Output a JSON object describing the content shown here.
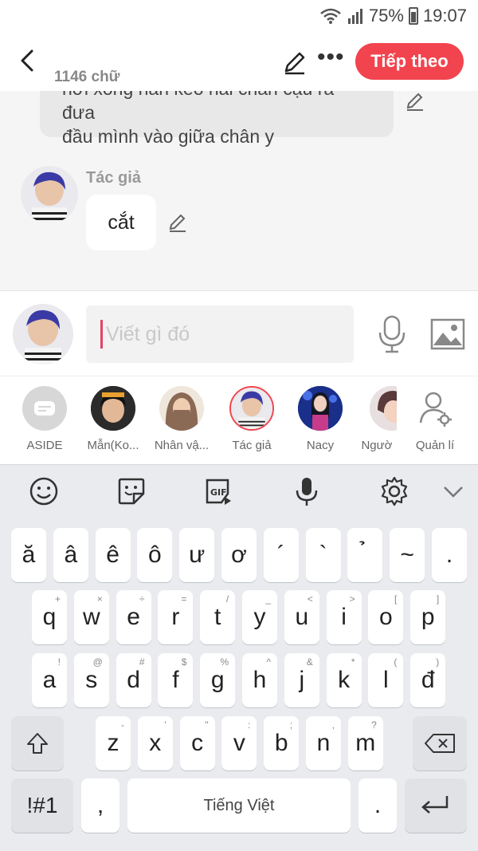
{
  "status_bar": {
    "battery": "75%",
    "time": "19:07"
  },
  "header": {
    "word_count": "1146 chữ",
    "next_label": "Tiếp theo"
  },
  "chat": {
    "prev_line1": "hơi xong hắn kéo hai chân cậu ra đưa",
    "prev_line2": "đầu mình vào giữa chân y",
    "author_role": "Tác giả",
    "message": "cắt"
  },
  "composer": {
    "placeholder": "Viết gì đó"
  },
  "characters": [
    {
      "name": "ASIDE"
    },
    {
      "name": "Mẫn(Ko..."
    },
    {
      "name": "Nhân vậ..."
    },
    {
      "name": "Tác giả"
    },
    {
      "name": "Nacy"
    },
    {
      "name": "Ngườ"
    },
    {
      "name": "Quản lí"
    }
  ],
  "keyboard": {
    "row0": [
      "ă",
      "â",
      "ê",
      "ô",
      "ư",
      "ơ",
      "´",
      "`",
      "̉",
      "~",
      "."
    ],
    "row1": [
      {
        "k": "q",
        "s": "+"
      },
      {
        "k": "w",
        "s": "×"
      },
      {
        "k": "e",
        "s": "÷"
      },
      {
        "k": "r",
        "s": "="
      },
      {
        "k": "t",
        "s": "/"
      },
      {
        "k": "y",
        "s": "_"
      },
      {
        "k": "u",
        "s": "<"
      },
      {
        "k": "i",
        "s": ">"
      },
      {
        "k": "o",
        "s": "["
      },
      {
        "k": "p",
        "s": "]"
      }
    ],
    "row2": [
      {
        "k": "a",
        "s": "!"
      },
      {
        "k": "s",
        "s": "@"
      },
      {
        "k": "d",
        "s": "#"
      },
      {
        "k": "f",
        "s": "$"
      },
      {
        "k": "g",
        "s": "%"
      },
      {
        "k": "h",
        "s": "^"
      },
      {
        "k": "j",
        "s": "&"
      },
      {
        "k": "k",
        "s": "*"
      },
      {
        "k": "l",
        "s": "("
      },
      {
        "k": "đ",
        "s": ")"
      }
    ],
    "row3": [
      {
        "k": "z",
        "s": "-"
      },
      {
        "k": "x",
        "s": "'"
      },
      {
        "k": "c",
        "s": "\""
      },
      {
        "k": "v",
        "s": ":"
      },
      {
        "k": "b",
        "s": ";"
      },
      {
        "k": "n",
        "s": ","
      },
      {
        "k": "m",
        "s": "?"
      }
    ],
    "symbols": "!#1",
    "comma": ",",
    "space": "Tiếng Việt",
    "period": "."
  },
  "colors": {
    "accent": "#f2444e",
    "caret": "#e8406a"
  }
}
